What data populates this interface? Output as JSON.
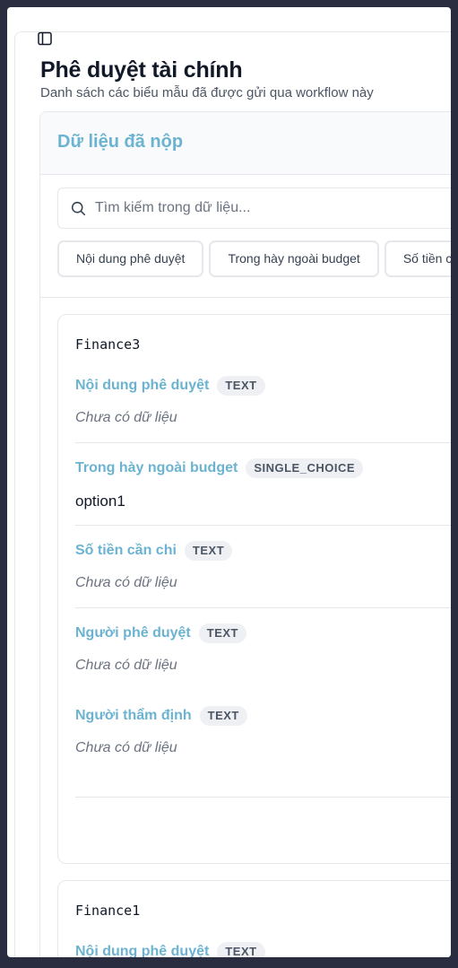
{
  "page": {
    "title": "Phê duyệt tài chính",
    "subtitle": "Danh sách các biểu mẫu đã được gửi qua workflow này"
  },
  "sidebar_toggle": {
    "icon": "sidebar-panel-icon"
  },
  "card": {
    "title": "Dữ liệu đã nộp",
    "search": {
      "placeholder": "Tìm kiếm trong dữ liệu...",
      "value": ""
    },
    "filter_chips": [
      "Nội dung phê duyệt",
      "Trong hày ngoài budget",
      "Số tiền cần chi"
    ]
  },
  "records": [
    {
      "name": "Finance3",
      "fields": [
        {
          "label": "Nội dung phê duyệt",
          "type": "TEXT",
          "value": "Chưa có dữ liệu",
          "empty": true
        },
        {
          "label": "Trong hày ngoài budget",
          "type": "SINGLE_CHOICE",
          "value": "option1",
          "empty": false
        },
        {
          "label": "Số tiền cần chi",
          "type": "TEXT",
          "value": "Chưa có dữ liệu",
          "empty": true
        },
        {
          "label": "Người phê duyệt",
          "type": "TEXT",
          "value": "Chưa có dữ liệu",
          "empty": true
        },
        {
          "label": "Người thẩm định",
          "type": "TEXT",
          "value": "Chưa có dữ liệu",
          "empty": true
        }
      ]
    },
    {
      "name": "Finance1",
      "fields": [
        {
          "label": "Nội dung phê duyệt",
          "type": "TEXT",
          "value": "",
          "empty": true
        }
      ]
    }
  ],
  "colors": {
    "background": "#2a2d3f",
    "accent": "#6bb3d0",
    "border": "#e5e7eb",
    "badge_bg": "#eef0f4"
  }
}
